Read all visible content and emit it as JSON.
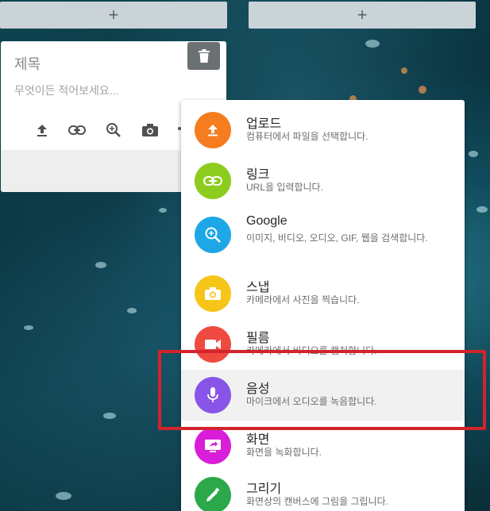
{
  "columns": [
    {
      "add_label": "+"
    },
    {
      "add_label": "+"
    }
  ],
  "note": {
    "title_placeholder": "제목",
    "body_placeholder": "무엇이든 적어보세요...",
    "tools": [
      "upload-icon",
      "link-icon",
      "search-zoom-icon",
      "camera-icon",
      "more-icon"
    ]
  },
  "menu": {
    "items": [
      {
        "title": "업로드",
        "desc": "컴퓨터에서 파일을 선택합니다.",
        "color": "#f57c1f",
        "icon": "upload-icon"
      },
      {
        "title": "링크",
        "desc": "URL을 입력합니다.",
        "color": "#8ccc1e",
        "icon": "link-icon"
      },
      {
        "title": "Google",
        "desc": "이미지, 비디오, 오디오, GIF, 웹을 검색합니다.",
        "color": "#1ea7e6",
        "icon": "search-zoom-icon"
      },
      {
        "title": "스냅",
        "desc": "카메라에서 사진을 찍습니다.",
        "color": "#f5c518",
        "icon": "camera-icon"
      },
      {
        "title": "필름",
        "desc": "카메라에서 비디오를 캡처합니다.",
        "color": "#ef4a3f",
        "icon": "video-camera-icon"
      },
      {
        "title": "음성",
        "desc": "마이크에서 오디오를 녹음합니다.",
        "color": "#8855e8",
        "icon": "microphone-icon"
      },
      {
        "title": "화면",
        "desc": "화면을 녹화합니다.",
        "color": "#d81ed8",
        "icon": "screen-record-icon"
      },
      {
        "title": "그리기",
        "desc": "화면상의 캔버스에 그림을 그립니다.",
        "color": "#2aa84a",
        "icon": "pencil-icon"
      }
    ],
    "selected_index": 5
  },
  "colors": {
    "highlight_border": "#d3232c",
    "menu_background": "#ffffff",
    "card_background": "#ffffff"
  }
}
